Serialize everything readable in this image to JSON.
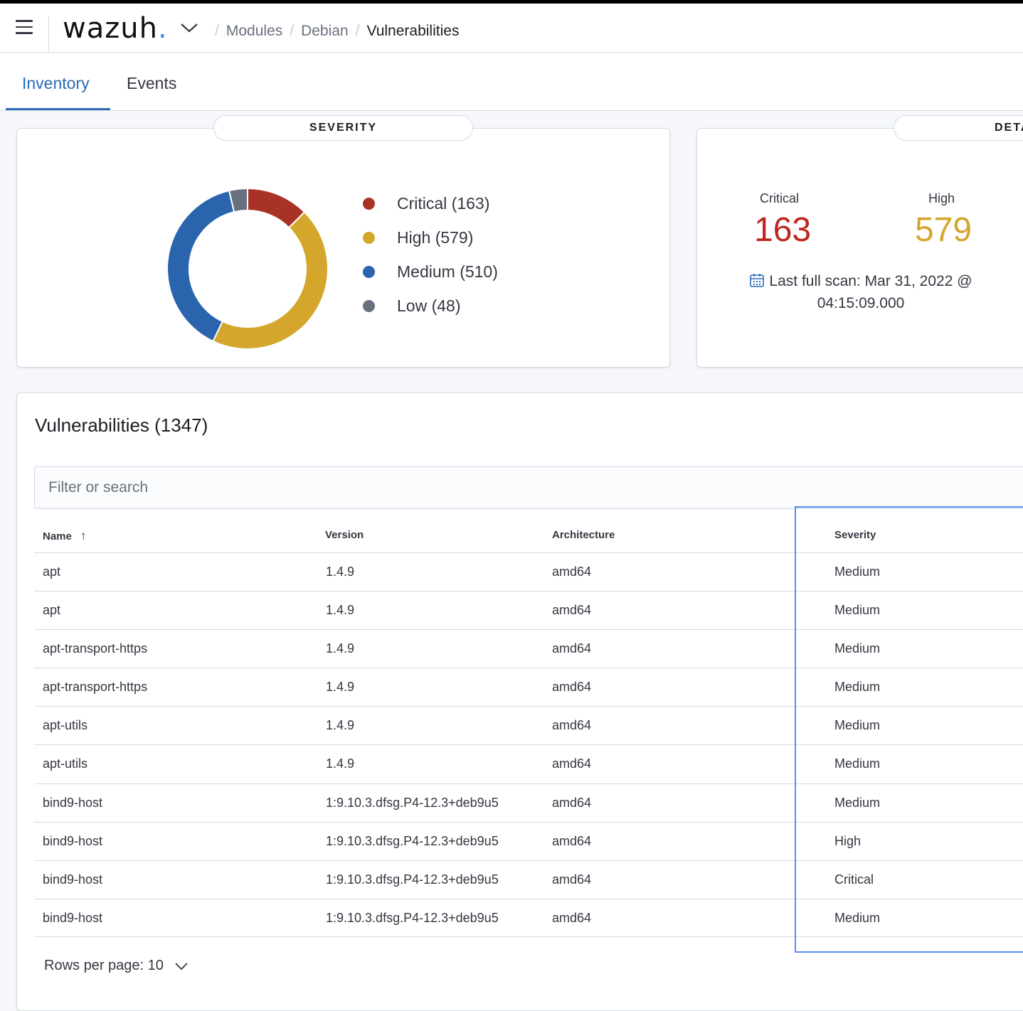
{
  "header": {
    "logo_text": "wazuh",
    "logo_dot": ".",
    "breadcrumb": [
      "Modules",
      "Debian",
      "Vulnerabilities"
    ],
    "separator": "/"
  },
  "tabs": [
    {
      "label": "Inventory",
      "active": true
    },
    {
      "label": "Events",
      "active": false
    }
  ],
  "severity_panel": {
    "title": "SEVERITY",
    "legend": [
      {
        "label": "Critical (163)",
        "color": "#a93226"
      },
      {
        "label": "High (579)",
        "color": "#d4a72c"
      },
      {
        "label": "Medium (510)",
        "color": "#2964ad"
      },
      {
        "label": "Low (48)",
        "color": "#69707d"
      }
    ]
  },
  "details_panel": {
    "title": "DETA",
    "critical_label": "Critical",
    "critical_value": "163",
    "high_label": "High",
    "high_value": "579",
    "last_scan": "Last full scan: Mar 31, 2022 @",
    "last_scan_time": "04:15:09.000",
    "colors": {
      "critical": "#bd271e",
      "high": "#d4a72c"
    }
  },
  "vulnerabilities": {
    "title": "Vulnerabilities (1347)",
    "search_placeholder": "Filter or search",
    "columns": [
      "Name",
      "Version",
      "Architecture",
      "Severity"
    ],
    "sort_indicator": "↑",
    "rows": [
      [
        "apt",
        "1.4.9",
        "amd64",
        "Medium"
      ],
      [
        "apt",
        "1.4.9",
        "amd64",
        "Medium"
      ],
      [
        "apt-transport-https",
        "1.4.9",
        "amd64",
        "Medium"
      ],
      [
        "apt-transport-https",
        "1.4.9",
        "amd64",
        "Medium"
      ],
      [
        "apt-utils",
        "1.4.9",
        "amd64",
        "Medium"
      ],
      [
        "apt-utils",
        "1.4.9",
        "amd64",
        "Medium"
      ],
      [
        "bind9-host",
        "1:9.10.3.dfsg.P4-12.3+deb9u5",
        "amd64",
        "Medium"
      ],
      [
        "bind9-host",
        "1:9.10.3.dfsg.P4-12.3+deb9u5",
        "amd64",
        "High"
      ],
      [
        "bind9-host",
        "1:9.10.3.dfsg.P4-12.3+deb9u5",
        "amd64",
        "Critical"
      ],
      [
        "bind9-host",
        "1:9.10.3.dfsg.P4-12.3+deb9u5",
        "amd64",
        "Medium"
      ]
    ],
    "rows_per_page": "Rows per page: 10"
  },
  "chart_data": {
    "type": "pie",
    "donut": true,
    "title": "SEVERITY",
    "categories": [
      "Critical",
      "High",
      "Medium",
      "Low"
    ],
    "values": [
      163,
      579,
      510,
      48
    ],
    "colors": [
      "#a93226",
      "#d4a72c",
      "#2964ad",
      "#69707d"
    ],
    "legend_position": "right"
  }
}
